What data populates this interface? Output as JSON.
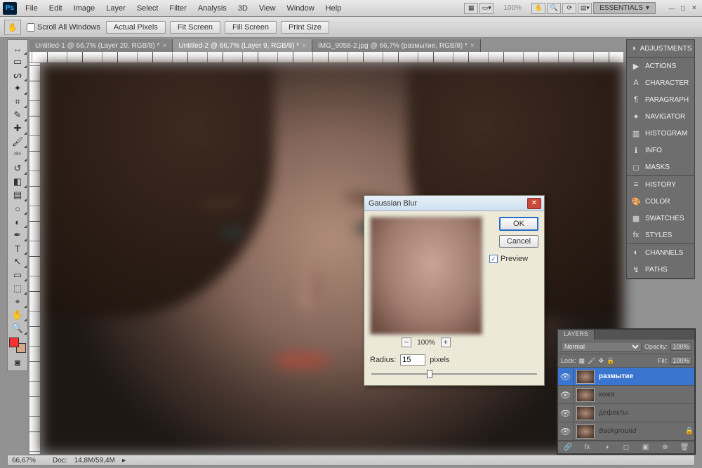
{
  "app": {
    "logo": "Ps",
    "workspace": "ESSENTIALS"
  },
  "menu": [
    "File",
    "Edit",
    "Image",
    "Layer",
    "Select",
    "Filter",
    "Analysis",
    "3D",
    "View",
    "Window",
    "Help"
  ],
  "menubar_zoom": "100%",
  "options": {
    "scroll_all": "Scroll All Windows",
    "btns": [
      "Actual Pixels",
      "Fit Screen",
      "Fill Screen",
      "Print Size"
    ]
  },
  "tabs": [
    {
      "label": "Untitled-1 @ 66,7% (Layer 20, RGB/8) *",
      "active": false
    },
    {
      "label": "Untitled-2 @ 66,7% (Layer 9, RGB/8) *",
      "active": true
    },
    {
      "label": "IMG_9058-2.jpg @ 66,7% (размытие, RGB/8) *",
      "active": false
    }
  ],
  "tools": [
    {
      "name": "move",
      "g": "↔"
    },
    {
      "name": "marquee",
      "g": "▭"
    },
    {
      "name": "lasso",
      "g": "ᔕ"
    },
    {
      "name": "wand",
      "g": "✦"
    },
    {
      "name": "crop",
      "g": "⌗"
    },
    {
      "name": "eyedrop",
      "g": "✎"
    },
    {
      "name": "heal",
      "g": "✚"
    },
    {
      "name": "brush",
      "g": "🖌"
    },
    {
      "name": "stamp",
      "g": "⎃"
    },
    {
      "name": "history-brush",
      "g": "↺"
    },
    {
      "name": "eraser",
      "g": "◧"
    },
    {
      "name": "gradient",
      "g": "▤"
    },
    {
      "name": "blur",
      "g": "○"
    },
    {
      "name": "dodge",
      "g": "◐"
    },
    {
      "name": "pen",
      "g": "✒"
    },
    {
      "name": "type",
      "g": "T"
    },
    {
      "name": "path-sel",
      "g": "↖"
    },
    {
      "name": "shape",
      "g": "▭"
    },
    {
      "name": "3d",
      "g": "⬚"
    },
    {
      "name": "3d-cam",
      "g": "⌖"
    },
    {
      "name": "hand",
      "g": "✋"
    },
    {
      "name": "zoom",
      "g": "🔍"
    }
  ],
  "right_dock": {
    "groups": [
      [
        {
          "icon": "◑",
          "label": "ADJUSTMENTS"
        }
      ],
      [
        {
          "icon": "▶",
          "label": "ACTIONS"
        },
        {
          "icon": "A",
          "label": "CHARACTER"
        },
        {
          "icon": "¶",
          "label": "PARAGRAPH"
        },
        {
          "icon": "✦",
          "label": "NAVIGATOR"
        },
        {
          "icon": "▥",
          "label": "HISTOGRAM"
        },
        {
          "icon": "ℹ",
          "label": "INFO"
        },
        {
          "icon": "◻",
          "label": "MASKS"
        }
      ],
      [
        {
          "icon": "≡",
          "label": "HISTORY"
        },
        {
          "icon": "🎨",
          "label": "COLOR"
        },
        {
          "icon": "▦",
          "label": "SWATCHES"
        },
        {
          "icon": "fx",
          "label": "STYLES"
        }
      ],
      [
        {
          "icon": "◐",
          "label": "CHANNELS"
        },
        {
          "icon": "↯",
          "label": "PATHS"
        }
      ]
    ]
  },
  "dialog": {
    "title": "Gaussian Blur",
    "ok": "OK",
    "cancel": "Cancel",
    "preview": "Preview",
    "zoom": "100%",
    "radius_label": "Radius:",
    "radius_value": "15",
    "radius_unit": "pixels"
  },
  "layers_panel": {
    "tab": "LAYERS",
    "blend": "Normal",
    "opacity_label": "Opacity:",
    "opacity": "100%",
    "lock_label": "Lock:",
    "fill_label": "Fill:",
    "fill": "100%",
    "rows": [
      {
        "name": "размытие",
        "sel": true,
        "locked": false,
        "italic": false
      },
      {
        "name": "кожа",
        "sel": false,
        "locked": false,
        "italic": false
      },
      {
        "name": "дефекты",
        "sel": false,
        "locked": false,
        "italic": false
      },
      {
        "name": "Background",
        "sel": false,
        "locked": true,
        "italic": true
      }
    ],
    "bottom_icons": [
      "🔗",
      "fx",
      "◑",
      "◻",
      "▣",
      "⊕",
      "🗑"
    ]
  },
  "status": {
    "zoom": "66,67%",
    "doc_label": "Doc:",
    "doc": "14,8M/59,4M"
  }
}
